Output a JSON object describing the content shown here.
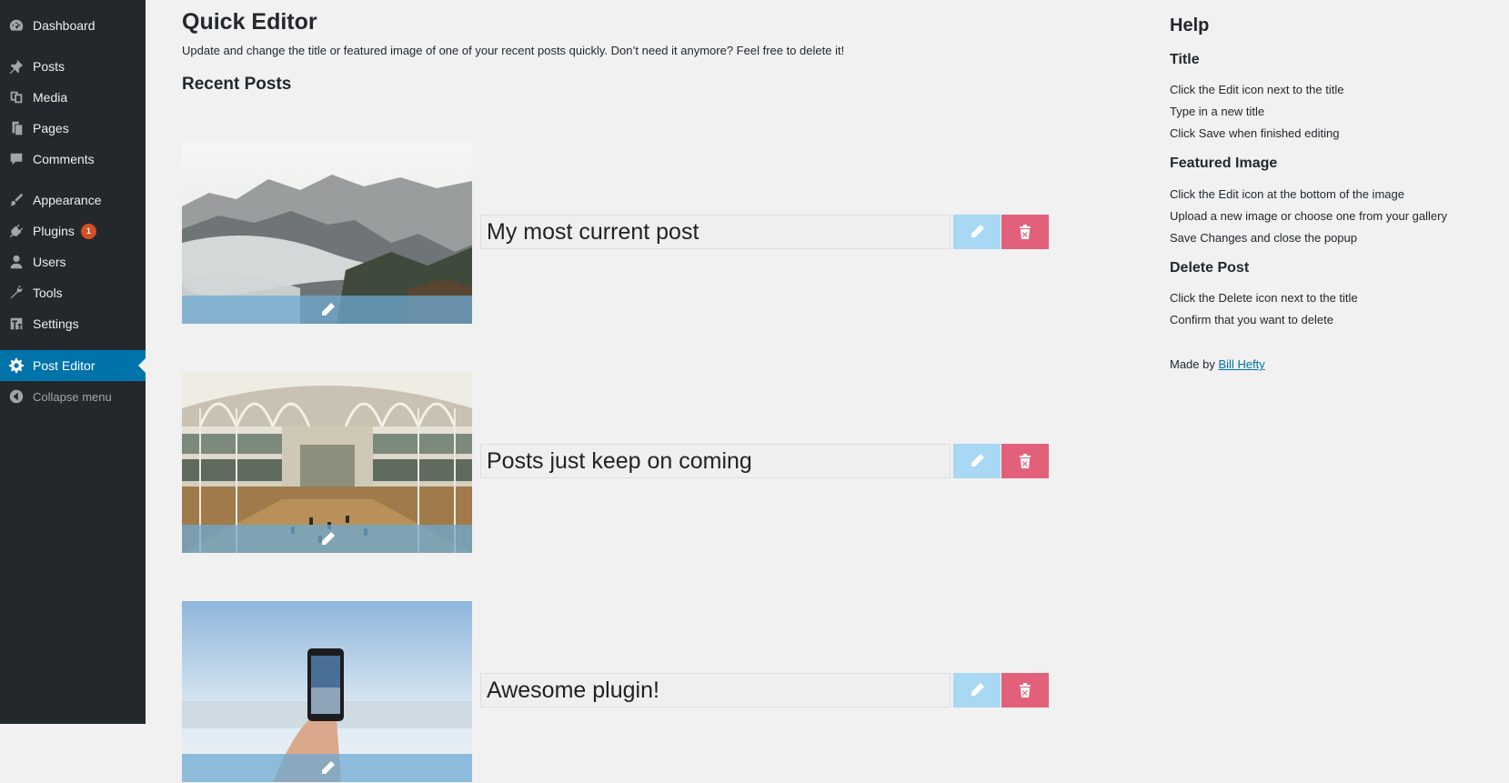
{
  "sidebar": {
    "items": [
      {
        "label": "Dashboard",
        "icon": "dashboard-icon"
      },
      {
        "label": "Posts",
        "icon": "pin-icon"
      },
      {
        "label": "Media",
        "icon": "media-icon"
      },
      {
        "label": "Pages",
        "icon": "pages-icon"
      },
      {
        "label": "Comments",
        "icon": "comment-icon"
      },
      {
        "label": "Appearance",
        "icon": "brush-icon"
      },
      {
        "label": "Plugins",
        "icon": "plug-icon",
        "badge": "1"
      },
      {
        "label": "Users",
        "icon": "user-icon"
      },
      {
        "label": "Tools",
        "icon": "wrench-icon"
      },
      {
        "label": "Settings",
        "icon": "settings-icon"
      },
      {
        "label": "Post Editor",
        "icon": "gear-icon",
        "active": true
      },
      {
        "label": "Collapse menu",
        "icon": "collapse-icon"
      }
    ]
  },
  "main": {
    "title": "Quick Editor",
    "description": "Update and change the title or featured image of one of your recent posts quickly. Don’t need it anymore? Feel free to delete it!",
    "section_title": "Recent Posts",
    "posts": [
      {
        "title": "My most current post",
        "image": "misty-mountains"
      },
      {
        "title": "Posts just keep on coming",
        "image": "museum-hall"
      },
      {
        "title": "Awesome plugin!",
        "image": "hand-holding-phone"
      }
    ]
  },
  "help": {
    "title": "Help",
    "sections": [
      {
        "heading": "Title",
        "lines": [
          "Click the Edit icon next to the title",
          "Type in a new title",
          "Click Save when finished editing"
        ]
      },
      {
        "heading": "Featured Image",
        "lines": [
          "Click the Edit icon at the bottom of the image",
          "Upload a new image or choose one from your gallery",
          "Save Changes and close the popup"
        ]
      },
      {
        "heading": "Delete Post",
        "lines": [
          "Click the Delete icon next to the title",
          "Confirm that you want to delete"
        ]
      }
    ],
    "made_by_prefix": "Made by",
    "made_by_author": "Bill Hefty"
  },
  "colors": {
    "sidebar_bg": "#23282d",
    "active_bg": "#0073aa",
    "edit_button": "#a9d8f5",
    "delete_button": "#e3607b",
    "badge": "#d54e21"
  }
}
